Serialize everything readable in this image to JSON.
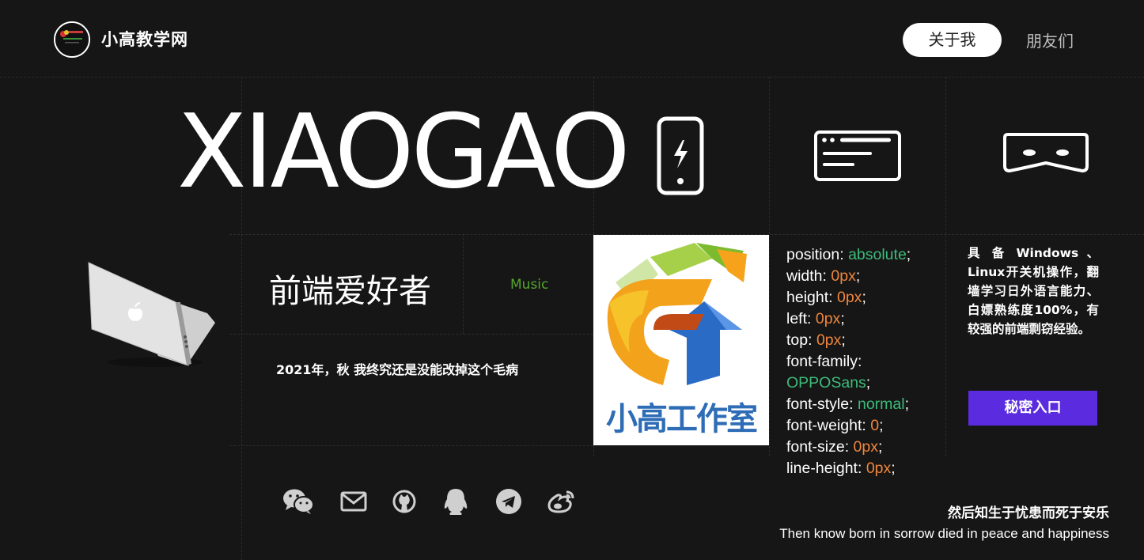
{
  "header": {
    "site_title": "小高教学网",
    "logo_icon": "avatar-logo",
    "nav": [
      {
        "label": "关于我",
        "active": true
      },
      {
        "label": "朋友们",
        "active": false
      }
    ]
  },
  "hero": {
    "title": "XIAOGAO",
    "icons": [
      "phone-charging-icon",
      "browser-window-icon",
      "vr-mask-icon"
    ]
  },
  "profile": {
    "tagline": "前端爱好者",
    "music_label": "Music",
    "diary": "2021年，秋 我终究还是没能改掉这个毛病",
    "studio_label": "小高工作室"
  },
  "css_snippet": [
    {
      "prop": "position",
      "value": "absolute",
      "kind": "keyword"
    },
    {
      "prop": "width",
      "value": "0px",
      "kind": "number"
    },
    {
      "prop": "height",
      "value": "0px",
      "kind": "number"
    },
    {
      "prop": "left",
      "value": "0px",
      "kind": "number"
    },
    {
      "prop": "top",
      "value": "0px",
      "kind": "number"
    },
    {
      "prop": "font-family",
      "value": "OPPOSans",
      "kind": "keyword"
    },
    {
      "prop": "font-style",
      "value": "normal",
      "kind": "keyword"
    },
    {
      "prop": "font-weight",
      "value": "0",
      "kind": "number"
    },
    {
      "prop": "font-size",
      "value": "0px",
      "kind": "number"
    },
    {
      "prop": "line-height",
      "value": "0px",
      "kind": "number"
    }
  ],
  "skills_text": "具 备 Windows 、Linux开关机操作，翻墙学习日外语言能力、白嫖熟练度100%，有较强的前端剽窃经验。",
  "secret_button": "秘密入口",
  "social_icons": [
    "wechat-icon",
    "email-icon",
    "github-icon",
    "qq-icon",
    "telegram-icon",
    "weibo-icon"
  ],
  "quote": {
    "cn": "然后知生于忧患而死于安乐",
    "en": "Then know born in sorrow died in peace and happiness"
  },
  "colors": {
    "background": "#161616",
    "keyword": "#3dbb7a",
    "number": "#f0863c",
    "button": "#5b2cdf",
    "music": "#55a630"
  }
}
